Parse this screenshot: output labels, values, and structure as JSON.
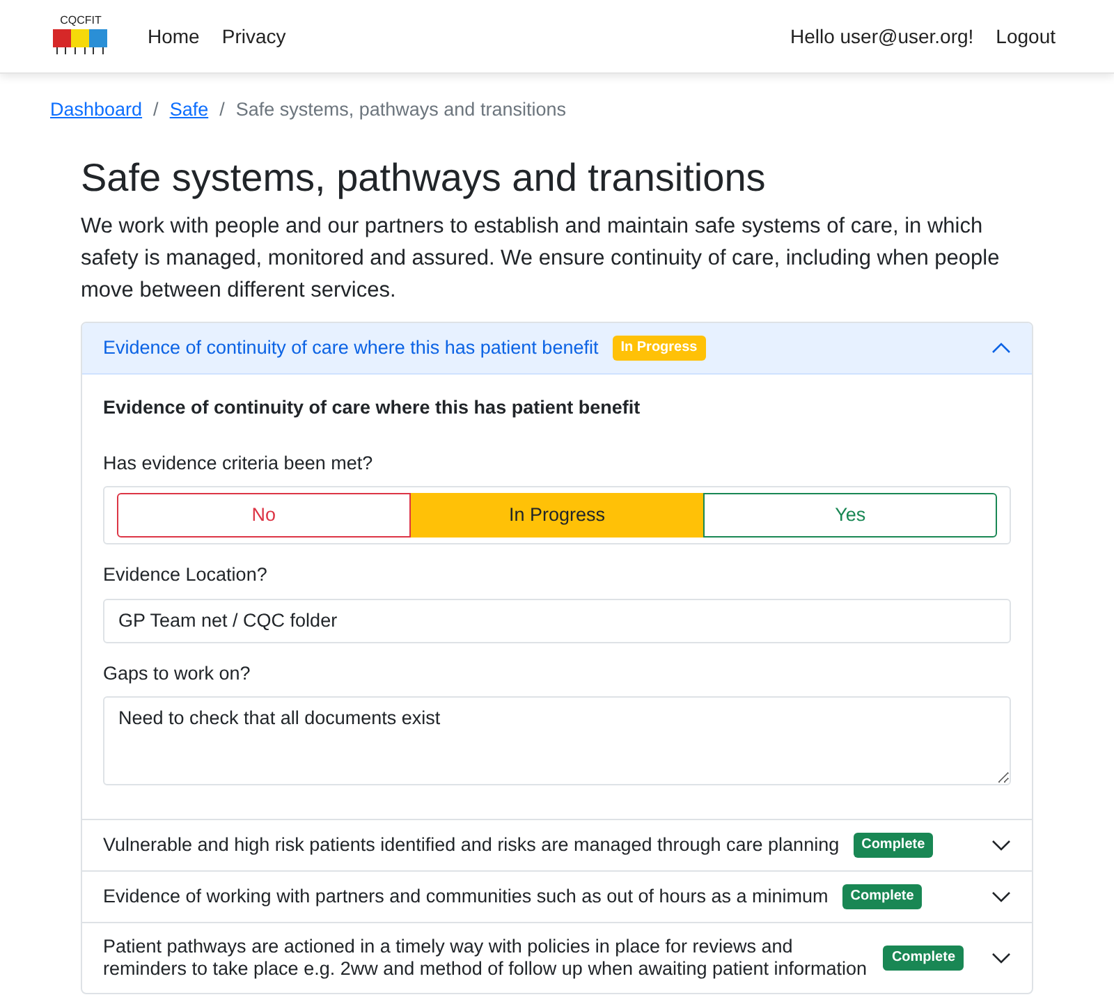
{
  "navbar": {
    "logo_text": "CQCFIT",
    "links": [
      {
        "label": "Home"
      },
      {
        "label": "Privacy"
      }
    ],
    "greeting": "Hello user@user.org!",
    "logout": "Logout"
  },
  "breadcrumb_separator": "/",
  "breadcrumb": [
    {
      "label": "Dashboard",
      "kind": "link"
    },
    {
      "label": "Safe",
      "kind": "link"
    },
    {
      "label": "Safe systems, pathways and transitions",
      "kind": "current"
    }
  ],
  "heading": "Safe systems, pathways and transitions",
  "intro": "We work with people and our partners to establish and maintain safe systems of care, in which safety is managed, monitored and assured. We ensure continuity of care, including when people move between different services.",
  "accordion": [
    {
      "title": "Evidence of continuity of care where this has patient benefit",
      "status": {
        "label": "In Progress",
        "kind": "progress"
      },
      "expanded": true,
      "body": {
        "heading": "Evidence of continuity of care where this has patient benefit",
        "question": "Has evidence criteria been met?",
        "options": [
          {
            "label": "No",
            "kind": "no",
            "selected": false
          },
          {
            "label": "In Progress",
            "kind": "progress",
            "selected": true
          },
          {
            "label": "Yes",
            "kind": "yes",
            "selected": false
          }
        ],
        "location_label": "Evidence Location?",
        "location_value": "GP Team net / CQC folder",
        "gaps_label": "Gaps to work on?",
        "gaps_value": "Need to check that all documents exist"
      }
    },
    {
      "title": "Vulnerable and high risk patients identified and risks are managed through care planning",
      "status": {
        "label": "Complete",
        "kind": "complete"
      },
      "expanded": false
    },
    {
      "title": "Evidence of working with partners and communities such as out of hours as a minimum",
      "status": {
        "label": "Complete",
        "kind": "complete"
      },
      "expanded": false
    },
    {
      "title": "Patient pathways are actioned in a timely way with policies in place for reviews and reminders to take place e.g. 2ww and method of follow up when awaiting patient information",
      "status": {
        "label": "Complete",
        "kind": "complete"
      },
      "expanded": false
    }
  ]
}
